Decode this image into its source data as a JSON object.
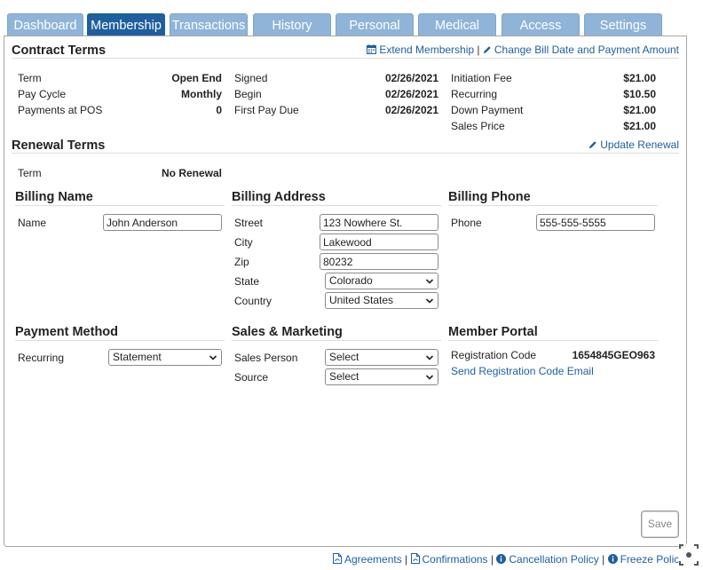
{
  "tabs": [
    {
      "label": "Dashboard"
    },
    {
      "label": "Membership"
    },
    {
      "label": "Transactions"
    },
    {
      "label": "History"
    },
    {
      "label": "Personal"
    },
    {
      "label": "Medical"
    },
    {
      "label": "Access"
    },
    {
      "label": "Settings"
    }
  ],
  "active_tab": "Membership",
  "contract": {
    "title": "Contract Terms",
    "extend_link": "Extend Membership",
    "change_link": "Change Bill Date and Payment Amount",
    "separator": "|",
    "term_label": "Term",
    "term_value": "Open End",
    "paycycle_label": "Pay Cycle",
    "paycycle_value": "Monthly",
    "pos_label": "Payments at POS",
    "pos_value": "0",
    "signed_label": "Signed",
    "signed_value": "02/26/2021",
    "begin_label": "Begin",
    "begin_value": "02/26/2021",
    "firstdue_label": "First Pay Due",
    "firstdue_value": "02/26/2021",
    "initfee_label": "Initiation Fee",
    "initfee_value": "$21.00",
    "recurring_label": "Recurring",
    "recurring_value": "$10.50",
    "downpay_label": "Down Payment",
    "downpay_value": "$21.00",
    "sales_label": "Sales Price",
    "sales_value": "$21.00"
  },
  "renewal": {
    "title": "Renewal Terms",
    "update_link": "Update Renewal",
    "term_label": "Term",
    "term_value": "No Renewal"
  },
  "billing_name": {
    "title": "Billing Name",
    "name_label": "Name",
    "name_value": "John Anderson"
  },
  "billing_address": {
    "title": "Billing Address",
    "street_label": "Street",
    "street_value": "123 Nowhere St.",
    "city_label": "City",
    "city_value": "Lakewood",
    "zip_label": "Zip",
    "zip_value": "80232",
    "state_label": "State",
    "state_value": "Colorado",
    "country_label": "Country",
    "country_value": "United States"
  },
  "billing_phone": {
    "title": "Billing Phone",
    "phone_label": "Phone",
    "phone_value": "555-555-5555"
  },
  "payment_method": {
    "title": "Payment Method",
    "recurring_label": "Recurring",
    "recurring_value": "Statement"
  },
  "sales_marketing": {
    "title": "Sales & Marketing",
    "person_label": "Sales Person",
    "person_value": "Select",
    "source_label": "Source",
    "source_value": "Select"
  },
  "member_portal": {
    "title": "Member Portal",
    "code_label": "Registration Code",
    "code_value": "1654845GEO963",
    "send_link": "Send Registration Code Email"
  },
  "save_label": "Save",
  "footer": {
    "agreements": "Agreements",
    "confirmations": "Confirmations",
    "cancellation": "Cancellation Policy",
    "freeze": "Freeze Polic",
    "separator": "|"
  },
  "colors": {
    "tab": "#8fb4d8",
    "tab_active": "#1f5f9e",
    "link": "#1f5f9e"
  }
}
